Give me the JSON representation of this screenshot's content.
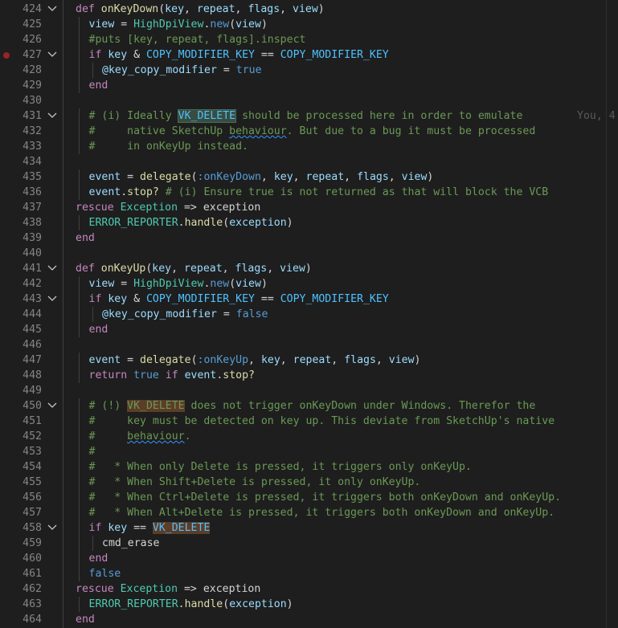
{
  "editor": {
    "blame_text": "You, 4",
    "lines": [
      {
        "n": "424",
        "fold": true,
        "bp": false,
        "indent": 0,
        "tokens": [
          [
            "kw2",
            "def "
          ],
          [
            "fn",
            "onKeyDown"
          ],
          [
            "p",
            "("
          ],
          [
            "var",
            "key"
          ],
          [
            "p",
            ", "
          ],
          [
            "var",
            "repeat"
          ],
          [
            "p",
            ", "
          ],
          [
            "var",
            "flags"
          ],
          [
            "p",
            ", "
          ],
          [
            "var",
            "view"
          ],
          [
            "p",
            ")"
          ]
        ]
      },
      {
        "n": "425",
        "fold": false,
        "bp": false,
        "indent": 1,
        "tokens": [
          [
            "var",
            "view"
          ],
          [
            "p",
            " = "
          ],
          [
            "cls",
            "HighDpiView"
          ],
          [
            "p",
            "."
          ],
          [
            "kw",
            "new"
          ],
          [
            "p",
            "("
          ],
          [
            "var",
            "view"
          ],
          [
            "p",
            ")"
          ]
        ]
      },
      {
        "n": "426",
        "fold": false,
        "bp": false,
        "indent": 1,
        "tokens": [
          [
            "cmt",
            "#puts [key, repeat, flags].inspect"
          ]
        ]
      },
      {
        "n": "427",
        "fold": true,
        "bp": true,
        "indent": 1,
        "tokens": [
          [
            "kw2",
            "if "
          ],
          [
            "var",
            "key"
          ],
          [
            "p",
            " & "
          ],
          [
            "const",
            "COPY_MODIFIER_KEY"
          ],
          [
            "p",
            " == "
          ],
          [
            "const",
            "COPY_MODIFIER_KEY"
          ]
        ]
      },
      {
        "n": "428",
        "fold": false,
        "bp": false,
        "indent": 2,
        "tokens": [
          [
            "ivar",
            "@key_copy_modifier"
          ],
          [
            "p",
            " = "
          ],
          [
            "bool",
            "true"
          ]
        ]
      },
      {
        "n": "429",
        "fold": false,
        "bp": false,
        "indent": 1,
        "tokens": [
          [
            "kw2",
            "end"
          ]
        ]
      },
      {
        "n": "430",
        "fold": false,
        "bp": false,
        "indent": 0,
        "tokens": []
      },
      {
        "n": "431",
        "fold": true,
        "bp": false,
        "indent": 1,
        "blame": true,
        "tokens": [
          [
            "cmt",
            "# (i) Ideally "
          ],
          [
            "cmt-sel",
            "VK_DELETE"
          ],
          [
            "cmt",
            " should be processed here in order to emulate"
          ]
        ]
      },
      {
        "n": "432",
        "fold": false,
        "bp": false,
        "indent": 1,
        "tokens": [
          [
            "cmt",
            "#     native SketchUp "
          ],
          [
            "cmt-squig",
            "behaviour"
          ],
          [
            "cmt",
            ". But due to a bug it must be processed"
          ]
        ]
      },
      {
        "n": "433",
        "fold": false,
        "bp": false,
        "indent": 1,
        "tokens": [
          [
            "cmt",
            "#     in onKeyUp instead."
          ]
        ]
      },
      {
        "n": "434",
        "fold": false,
        "bp": false,
        "indent": 0,
        "tokens": []
      },
      {
        "n": "435",
        "fold": false,
        "bp": false,
        "indent": 1,
        "tokens": [
          [
            "var",
            "event"
          ],
          [
            "p",
            " = "
          ],
          [
            "fn",
            "delegate"
          ],
          [
            "p",
            "("
          ],
          [
            "sym",
            ":onKeyDown"
          ],
          [
            "p",
            ", "
          ],
          [
            "var",
            "key"
          ],
          [
            "p",
            ", "
          ],
          [
            "var",
            "repeat"
          ],
          [
            "p",
            ", "
          ],
          [
            "var",
            "flags"
          ],
          [
            "p",
            ", "
          ],
          [
            "var",
            "view"
          ],
          [
            "p",
            ")"
          ]
        ]
      },
      {
        "n": "436",
        "fold": false,
        "bp": false,
        "indent": 1,
        "tokens": [
          [
            "var",
            "event"
          ],
          [
            "p",
            "."
          ],
          [
            "fn",
            "stop?"
          ],
          [
            "p",
            " "
          ],
          [
            "cmt",
            "# (i) Ensure true is not returned as that will block the VCB"
          ]
        ]
      },
      {
        "n": "437",
        "fold": false,
        "bp": false,
        "indent": 0,
        "tokens": [
          [
            "kw2",
            "rescue "
          ],
          [
            "cls",
            "Exception"
          ],
          [
            "p",
            " => "
          ],
          [
            "p",
            "exception"
          ]
        ]
      },
      {
        "n": "438",
        "fold": false,
        "bp": false,
        "indent": 1,
        "tokens": [
          [
            "cls",
            "ERROR_REPORTER"
          ],
          [
            "p",
            "."
          ],
          [
            "fn",
            "handle"
          ],
          [
            "p",
            "("
          ],
          [
            "var",
            "exception"
          ],
          [
            "p",
            ")"
          ]
        ]
      },
      {
        "n": "439",
        "fold": false,
        "bp": false,
        "indent": 0,
        "tokens": [
          [
            "kw2",
            "end"
          ]
        ]
      },
      {
        "n": "440",
        "fold": false,
        "bp": false,
        "indent": 0,
        "tokens": []
      },
      {
        "n": "441",
        "fold": true,
        "bp": false,
        "indent": 0,
        "tokens": [
          [
            "kw2",
            "def "
          ],
          [
            "fn",
            "onKeyUp"
          ],
          [
            "p",
            "("
          ],
          [
            "var",
            "key"
          ],
          [
            "p",
            ", "
          ],
          [
            "var",
            "repeat"
          ],
          [
            "p",
            ", "
          ],
          [
            "var",
            "flags"
          ],
          [
            "p",
            ", "
          ],
          [
            "var",
            "view"
          ],
          [
            "p",
            ")"
          ]
        ]
      },
      {
        "n": "442",
        "fold": false,
        "bp": false,
        "indent": 1,
        "tokens": [
          [
            "var",
            "view"
          ],
          [
            "p",
            " = "
          ],
          [
            "cls",
            "HighDpiView"
          ],
          [
            "p",
            "."
          ],
          [
            "kw",
            "new"
          ],
          [
            "p",
            "("
          ],
          [
            "var",
            "view"
          ],
          [
            "p",
            ")"
          ]
        ]
      },
      {
        "n": "443",
        "fold": true,
        "bp": false,
        "indent": 1,
        "tokens": [
          [
            "kw2",
            "if "
          ],
          [
            "var",
            "key"
          ],
          [
            "p",
            " & "
          ],
          [
            "const",
            "COPY_MODIFIER_KEY"
          ],
          [
            "p",
            " == "
          ],
          [
            "const",
            "COPY_MODIFIER_KEY"
          ]
        ]
      },
      {
        "n": "444",
        "fold": false,
        "bp": false,
        "indent": 2,
        "tokens": [
          [
            "ivar",
            "@key_copy_modifier"
          ],
          [
            "p",
            " = "
          ],
          [
            "bool",
            "false"
          ]
        ]
      },
      {
        "n": "445",
        "fold": false,
        "bp": false,
        "indent": 1,
        "tokens": [
          [
            "kw2",
            "end"
          ]
        ]
      },
      {
        "n": "446",
        "fold": false,
        "bp": false,
        "indent": 0,
        "tokens": []
      },
      {
        "n": "447",
        "fold": false,
        "bp": false,
        "indent": 1,
        "tokens": [
          [
            "var",
            "event"
          ],
          [
            "p",
            " = "
          ],
          [
            "fn",
            "delegate"
          ],
          [
            "p",
            "("
          ],
          [
            "sym",
            ":onKeyUp"
          ],
          [
            "p",
            ", "
          ],
          [
            "var",
            "key"
          ],
          [
            "p",
            ", "
          ],
          [
            "var",
            "repeat"
          ],
          [
            "p",
            ", "
          ],
          [
            "var",
            "flags"
          ],
          [
            "p",
            ", "
          ],
          [
            "var",
            "view"
          ],
          [
            "p",
            ")"
          ]
        ]
      },
      {
        "n": "448",
        "fold": false,
        "bp": false,
        "indent": 1,
        "tokens": [
          [
            "kw2",
            "return "
          ],
          [
            "bool",
            "true"
          ],
          [
            "kw2",
            " if "
          ],
          [
            "var",
            "event"
          ],
          [
            "p",
            "."
          ],
          [
            "fn",
            "stop?"
          ]
        ]
      },
      {
        "n": "449",
        "fold": false,
        "bp": false,
        "indent": 0,
        "tokens": []
      },
      {
        "n": "450",
        "fold": true,
        "bp": false,
        "indent": 1,
        "tokens": [
          [
            "cmt",
            "# (!) "
          ],
          [
            "cmt-word",
            "VK_DELETE"
          ],
          [
            "cmt",
            " does not trigger onKeyDown under Windows. Therefor the"
          ]
        ]
      },
      {
        "n": "451",
        "fold": false,
        "bp": false,
        "indent": 1,
        "tokens": [
          [
            "cmt",
            "#     key must be detected on key up. This deviate from SketchUp's native"
          ]
        ]
      },
      {
        "n": "452",
        "fold": false,
        "bp": false,
        "indent": 1,
        "tokens": [
          [
            "cmt",
            "#     "
          ],
          [
            "cmt-squig",
            "behaviour"
          ],
          [
            "cmt",
            "."
          ]
        ]
      },
      {
        "n": "453",
        "fold": false,
        "bp": false,
        "indent": 1,
        "tokens": [
          [
            "cmt",
            "#"
          ]
        ]
      },
      {
        "n": "454",
        "fold": false,
        "bp": false,
        "indent": 1,
        "tokens": [
          [
            "cmt",
            "#   * When only Delete is pressed, it triggers only onKeyUp."
          ]
        ]
      },
      {
        "n": "455",
        "fold": false,
        "bp": false,
        "indent": 1,
        "tokens": [
          [
            "cmt",
            "#   * When Shift+Delete is pressed, it only onKeyUp."
          ]
        ]
      },
      {
        "n": "456",
        "fold": false,
        "bp": false,
        "indent": 1,
        "tokens": [
          [
            "cmt",
            "#   * When Ctrl+Delete is pressed, it triggers both onKeyDown and onKeyUp."
          ]
        ]
      },
      {
        "n": "457",
        "fold": false,
        "bp": false,
        "indent": 1,
        "tokens": [
          [
            "cmt",
            "#   * When Alt+Delete is pressed, it triggers both onKeyDown and onKeyUp."
          ]
        ]
      },
      {
        "n": "458",
        "fold": true,
        "bp": false,
        "indent": 1,
        "tokens": [
          [
            "kw2",
            "if "
          ],
          [
            "var",
            "key"
          ],
          [
            "p",
            " == "
          ],
          [
            "const-word",
            "VK_DELETE"
          ]
        ]
      },
      {
        "n": "459",
        "fold": false,
        "bp": false,
        "indent": 2,
        "tokens": [
          [
            "p",
            "cmd_erase"
          ]
        ]
      },
      {
        "n": "460",
        "fold": false,
        "bp": false,
        "indent": 1,
        "tokens": [
          [
            "kw2",
            "end"
          ]
        ]
      },
      {
        "n": "461",
        "fold": false,
        "bp": false,
        "indent": 1,
        "tokens": [
          [
            "bool",
            "false"
          ]
        ]
      },
      {
        "n": "462",
        "fold": false,
        "bp": false,
        "indent": 0,
        "tokens": [
          [
            "kw2",
            "rescue "
          ],
          [
            "cls",
            "Exception"
          ],
          [
            "p",
            " => "
          ],
          [
            "p",
            "exception"
          ]
        ]
      },
      {
        "n": "463",
        "fold": false,
        "bp": false,
        "indent": 1,
        "tokens": [
          [
            "cls",
            "ERROR_REPORTER"
          ],
          [
            "p",
            "."
          ],
          [
            "fn",
            "handle"
          ],
          [
            "p",
            "("
          ],
          [
            "var",
            "exception"
          ],
          [
            "p",
            ")"
          ]
        ]
      },
      {
        "n": "464",
        "fold": false,
        "bp": false,
        "indent": 0,
        "tokens": [
          [
            "kw2",
            "end"
          ]
        ]
      }
    ]
  }
}
